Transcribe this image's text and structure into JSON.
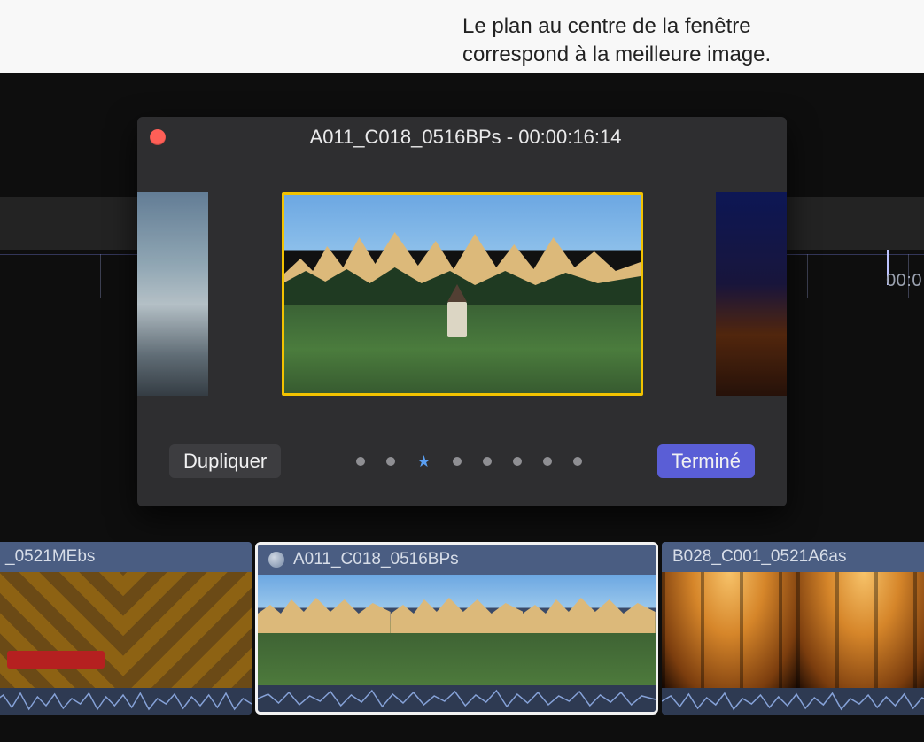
{
  "annotation": "Le plan au centre de la fenêtre\ncorrespond à la meilleure image.",
  "popup": {
    "title": "A011_C018_0516BPs - 00:00:16:14",
    "duplicate_label": "Dupliquer",
    "done_label": "Terminé",
    "pager": {
      "count": 8,
      "active_index": 2
    }
  },
  "ruler": {
    "visible_time_label": "00:0"
  },
  "timeline": {
    "clips": [
      {
        "label": "_0521MEbs"
      },
      {
        "label": "A011_C018_0516BPs"
      },
      {
        "label": "B028_C001_0521A6as"
      }
    ]
  }
}
